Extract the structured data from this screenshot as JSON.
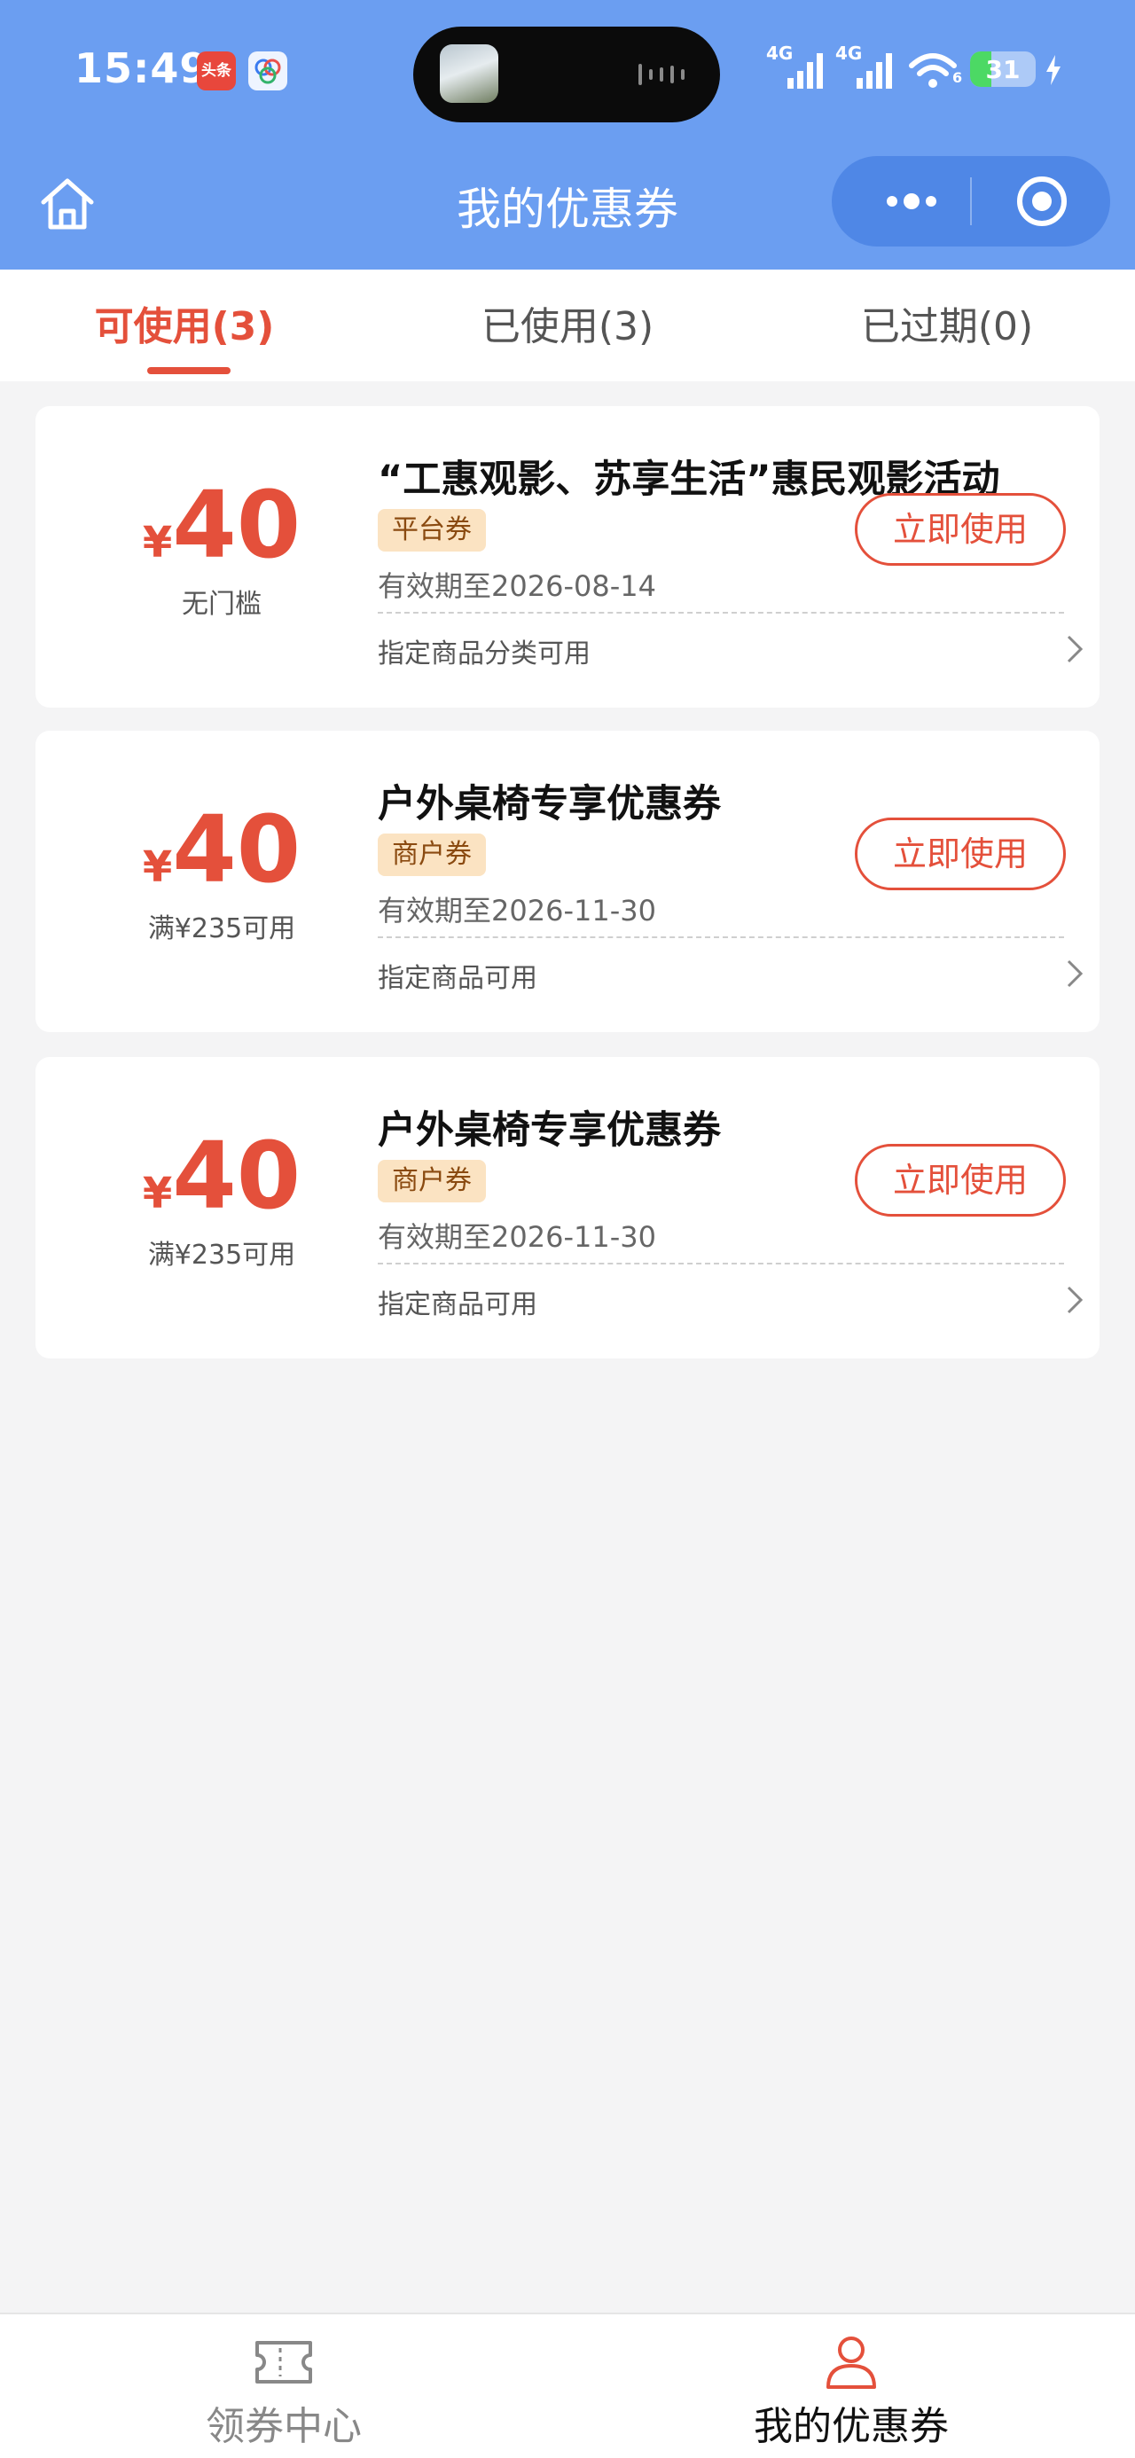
{
  "status_bar": {
    "time": "15:49",
    "toutiao_badge": "头条",
    "signal_1": "4G",
    "signal_2": "4G",
    "battery": "31",
    "wifi_sub": "6"
  },
  "nav": {
    "title": "我的优惠券",
    "home_icon": "home-icon",
    "more_icon": "more-dots-icon",
    "close_icon": "target-close-icon"
  },
  "tabs": [
    {
      "label": "可使用(3)",
      "active": true
    },
    {
      "label": "已使用(3)",
      "active": false
    },
    {
      "label": "已过期(0)",
      "active": false
    }
  ],
  "coupons": [
    {
      "currency": "¥",
      "amount": "40",
      "threshold": "无门槛",
      "title": "“工惠观影、苏享生活”惠民观影活动",
      "tag": "平台券",
      "expiry": "有效期至2026-08-14",
      "scope": "指定商品分类可用",
      "button": "立即使用"
    },
    {
      "currency": "¥",
      "amount": "40",
      "threshold": "满¥235可用",
      "title": "户外桌椅专享优惠券",
      "tag": "商户券",
      "expiry": "有效期至2026-11-30",
      "scope": "指定商品可用",
      "button": "立即使用"
    },
    {
      "currency": "¥",
      "amount": "40",
      "threshold": "满¥235可用",
      "title": "户外桌椅专享优惠券",
      "tag": "商户券",
      "expiry": "有效期至2026-11-30",
      "scope": "指定商品可用",
      "button": "立即使用"
    }
  ],
  "bottom_nav": [
    {
      "label": "领券中心",
      "icon": "ticket-icon",
      "active": false
    },
    {
      "label": "我的优惠券",
      "icon": "user-icon",
      "active": true
    }
  ],
  "colors": {
    "header_blue": "#6b9ef1",
    "accent_red": "#e4503b",
    "tag_bg": "#fbe3c2",
    "page_bg": "#f4f4f5"
  }
}
